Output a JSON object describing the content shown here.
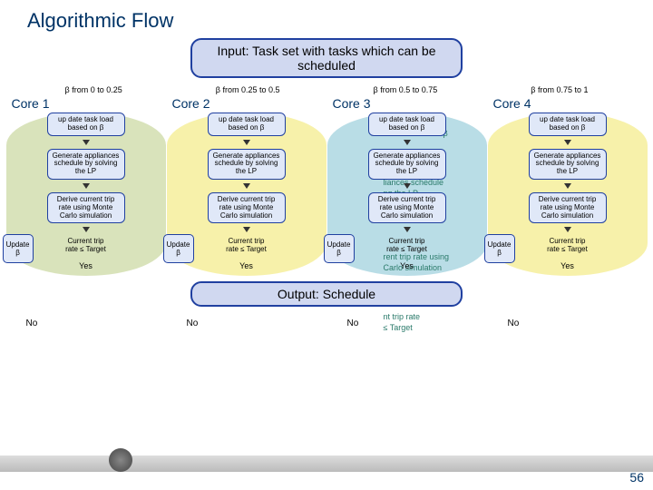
{
  "title": "Algorithmic Flow",
  "input": "Input: Task set with tasks which can be scheduled",
  "output": "Output: Schedule",
  "ranges": [
    "β from 0 to 0.25",
    "β from 0.25 to 0.5",
    "β from 0.5 to 0.75",
    "β from 0.75 to 1"
  ],
  "cores": [
    {
      "label": "Core 1",
      "steps": {
        "s1": "up date task load based on β",
        "s2": "Generate appliances schedule by solving the LP",
        "s3": "Derive current trip rate using Monte Carlo simulation",
        "dec": "Current trip rate ≤ Target",
        "upd": "Update β",
        "no": "No",
        "yes": "Yes"
      }
    },
    {
      "label": "Core 2",
      "steps": {
        "s1": "up date task load based on β",
        "s2": "Generate appliances schedule by solving the LP",
        "s3": "Derive current trip rate using Monte Carlo simulation",
        "dec": "Current trip rate ≤ Target",
        "upd": "Update β",
        "no": "No",
        "yes": "Yes"
      }
    },
    {
      "label": "Core 3",
      "steps": {
        "s1": "up date task load based on β",
        "s2": "Generate appliances schedule by solving the LP",
        "s3": "Derive current trip rate using Monte Carlo simulation",
        "dec": "Current trip rate ≤ Target",
        "upd": "Update β",
        "no": "No",
        "yes": "Yes"
      }
    },
    {
      "label": "Core 4",
      "steps": {
        "s1": "up date task load based on β",
        "s2": "Generate appliances schedule by solving the LP",
        "s3": "Derive current trip rate using Monte Carlo simulation",
        "dec": "Current trip rate ≤ Target",
        "upd": "Update β",
        "no": "No",
        "yes": "Yes"
      }
    }
  ],
  "ghost": {
    "g1": "k load based on β",
    "g2": "liances schedule",
    "g3": "ng the LP",
    "g4": "rent trip rate using",
    "g5": "Carlo simulation",
    "g6": "nt trip rate",
    "g7": "≤ Target"
  },
  "pagenum": "56"
}
